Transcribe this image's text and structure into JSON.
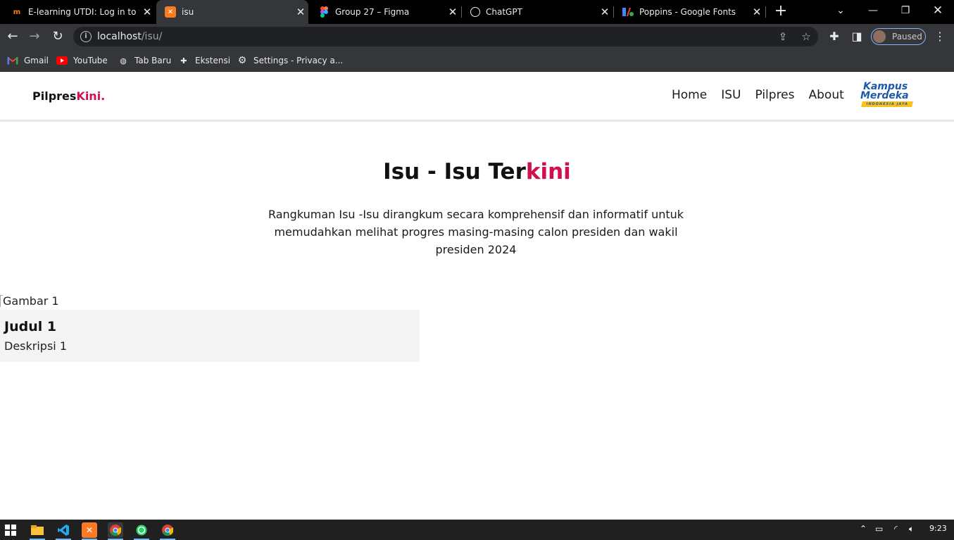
{
  "browser": {
    "tabs": [
      {
        "title": "E-learning UTDI: Log in to th",
        "icon": "moodle-icon",
        "active": false
      },
      {
        "title": "isu",
        "icon": "xampp-icon",
        "active": true
      },
      {
        "title": "Group 27 – Figma",
        "icon": "figma-icon",
        "active": false
      },
      {
        "title": "ChatGPT",
        "icon": "chatgpt-icon",
        "active": false
      },
      {
        "title": "Poppins - Google Fonts",
        "icon": "google-fonts-icon",
        "active": false
      }
    ],
    "url_host": "localhost",
    "url_path": "/isu/",
    "profile_status": "Paused",
    "bookmarks": [
      {
        "label": "Gmail",
        "icon": "gmail-icon"
      },
      {
        "label": "YouTube",
        "icon": "youtube-icon"
      },
      {
        "label": "Tab Baru",
        "icon": "globe-icon"
      },
      {
        "label": "Ekstensi",
        "icon": "puzzle-icon"
      },
      {
        "label": "Settings - Privacy a...",
        "icon": "gear-icon"
      }
    ]
  },
  "site": {
    "brand_main": "Pilpres",
    "brand_accent": "Kini.",
    "nav": [
      "Home",
      "ISU",
      "Pilpres",
      "About"
    ],
    "logo": {
      "line1": "Kampus",
      "line2": "Merdeka",
      "line3": "INDONESIA JAYA"
    },
    "hero": {
      "title_main": "Isu - Isu Ter",
      "title_accent": "kini",
      "description": "Rangkuman Isu -Isu dirangkum secara komprehensif dan informatif untuk memudahkan melihat progres masing-masing calon presiden dan wakil presiden 2024"
    },
    "card": {
      "image_alt": "Gambar 1",
      "title": "Judul 1",
      "description": "Deskripsi 1"
    },
    "accent_color": "#d0104c"
  },
  "taskbar": {
    "time": "9:23",
    "apps": [
      "windows-start-icon",
      "file-explorer-icon",
      "vscode-icon",
      "xampp-icon",
      "chrome-icon",
      "whatsapp-icon",
      "chrome-alt-icon"
    ]
  }
}
